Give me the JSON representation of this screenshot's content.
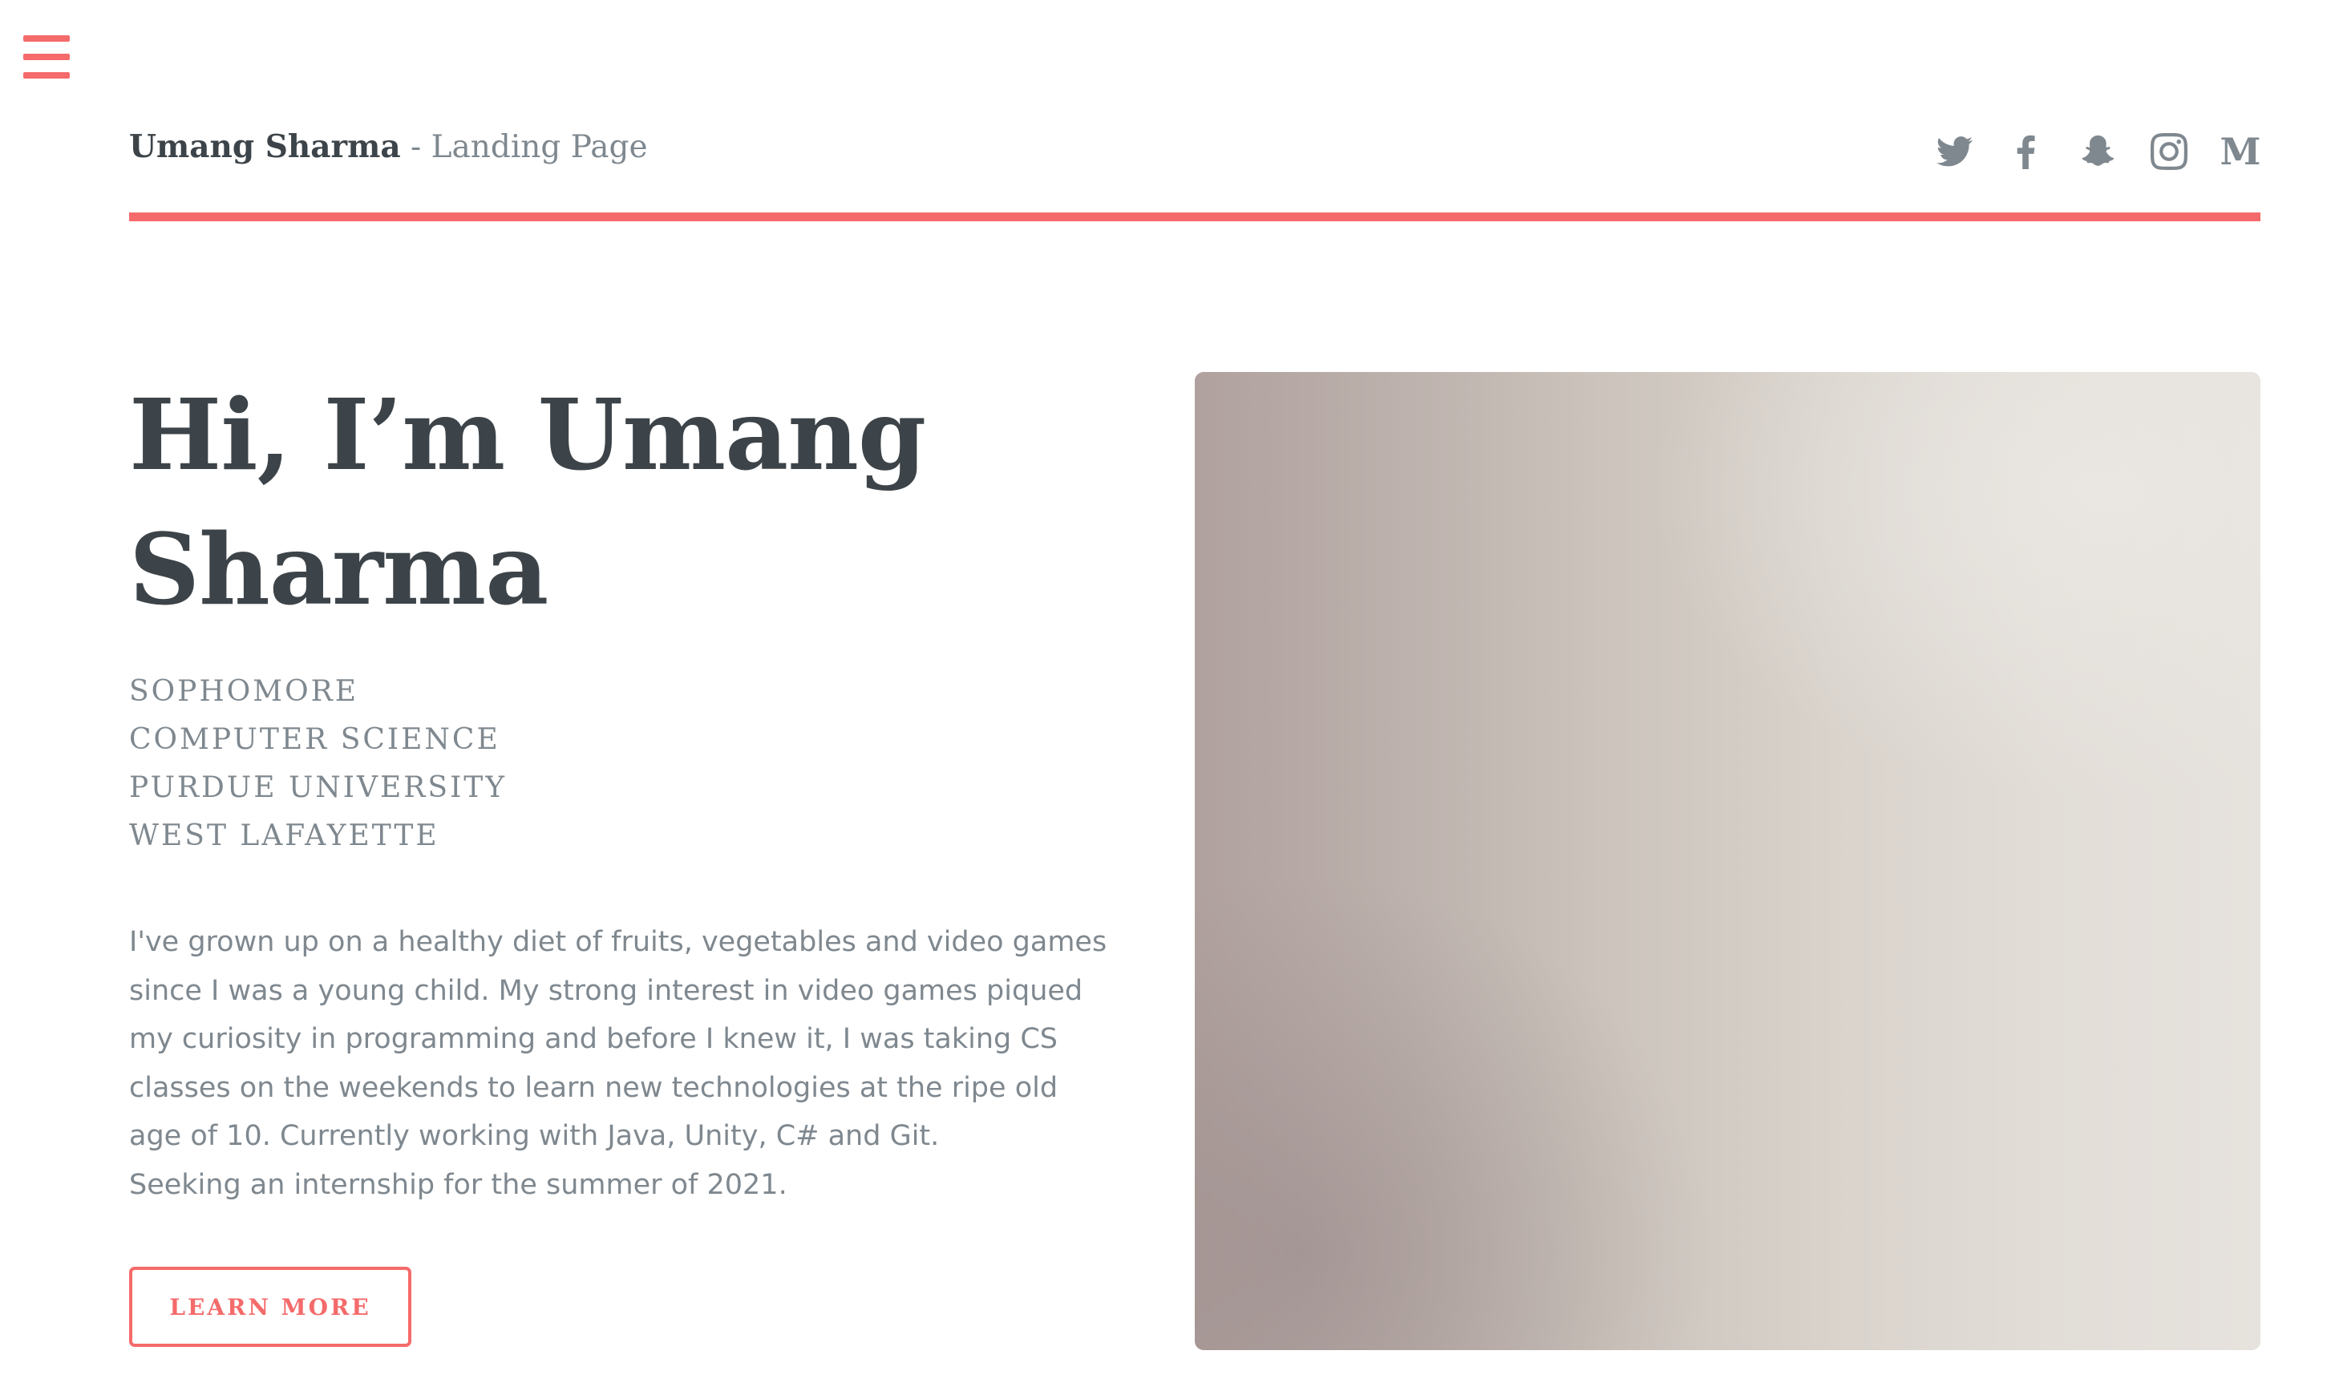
{
  "header": {
    "logo_name": "Umang Sharma",
    "logo_suffix": " - Landing Page",
    "social_icons": [
      "twitter-icon",
      "facebook-icon",
      "snapchat-icon",
      "instagram-icon",
      "medium-icon"
    ],
    "medium_glyph": "M"
  },
  "hero": {
    "title_line1": "Hi, I’m Umang",
    "title_line2": "Sharma",
    "subtitles": [
      "SOPHOMORE",
      "COMPUTER SCIENCE",
      "PURDUE UNIVERSITY",
      "WEST LAFAYETTE"
    ],
    "body_lines": [
      "I've grown up on a healthy diet of fruits, vegetables and video games",
      "since I was a young child. My strong interest in video games piqued",
      "my curiosity in programming and before I knew it, I was taking CS",
      "classes on the weekends to learn new technologies at the ripe old",
      "age of 10. Currently working with Java, Unity, C# and Git.",
      "Seeking an internship for the summer of 2021."
    ],
    "button_label": "LEARN MORE"
  },
  "colors": {
    "accent": "#f56a6a",
    "heading": "#3d4449",
    "text": "#7f888f",
    "background": "#ffffff"
  }
}
